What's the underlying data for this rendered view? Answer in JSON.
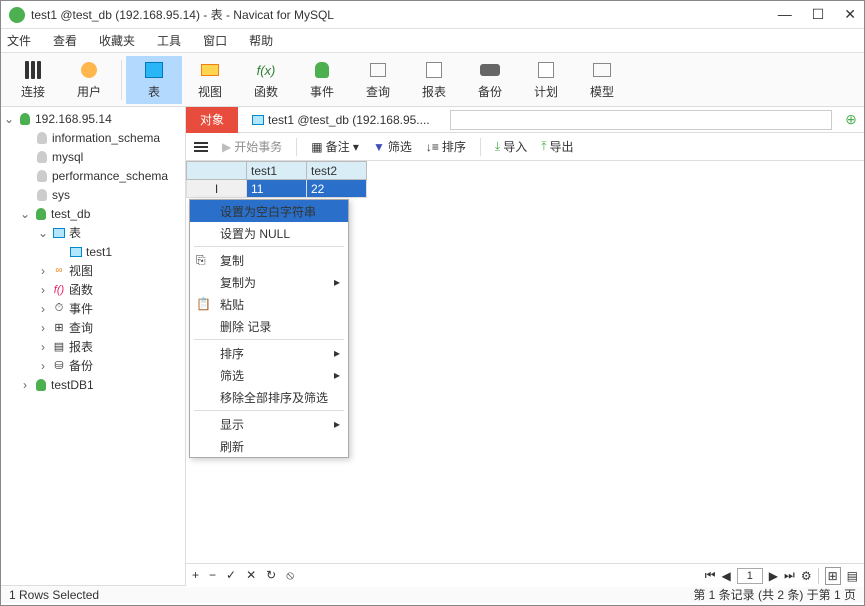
{
  "window": {
    "title": "test1 @test_db (192.168.95.14) - 表 - Navicat for MySQL"
  },
  "menubar": [
    "文件",
    "查看",
    "收藏夹",
    "工具",
    "窗口",
    "帮助"
  ],
  "toolbar": [
    {
      "label": "连接",
      "icon": "conn"
    },
    {
      "label": "用户",
      "icon": "user"
    },
    {
      "label": "表",
      "icon": "table",
      "active": true
    },
    {
      "label": "视图",
      "icon": "view"
    },
    {
      "label": "函数",
      "icon": "fn"
    },
    {
      "label": "事件",
      "icon": "event"
    },
    {
      "label": "查询",
      "icon": "query"
    },
    {
      "label": "报表",
      "icon": "report"
    },
    {
      "label": "备份",
      "icon": "backup"
    },
    {
      "label": "计划",
      "icon": "calendar"
    },
    {
      "label": "模型",
      "icon": "model"
    }
  ],
  "sidebar": {
    "connection": "192.168.95.14",
    "dbs_grey": [
      "information_schema",
      "mysql",
      "performance_schema",
      "sys"
    ],
    "db_open": {
      "name": "test_db",
      "tables_label": "表",
      "tables": [
        "test1"
      ],
      "children": [
        {
          "label": "视图",
          "icon": "view"
        },
        {
          "label": "函数",
          "icon": "fn"
        },
        {
          "label": "事件",
          "icon": "event"
        },
        {
          "label": "查询",
          "icon": "query"
        },
        {
          "label": "报表",
          "icon": "report"
        },
        {
          "label": "备份",
          "icon": "backup"
        }
      ]
    },
    "db_closed": "testDB1"
  },
  "tabs": {
    "active": "对象",
    "second": "test1 @test_db (192.168.95...."
  },
  "subtoolbar": {
    "begin": "开始事务",
    "memo": "备注 ▾",
    "filter": "筛选",
    "sort": "排序",
    "import": "导入",
    "export": "导出"
  },
  "grid": {
    "columns": [
      "test1",
      "test2"
    ],
    "rows": [
      [
        "11",
        "22"
      ]
    ]
  },
  "context_menu": [
    {
      "label": "设置为空白字符串",
      "highlighted": true
    },
    {
      "label": "设置为 NULL"
    },
    {
      "sep": true
    },
    {
      "label": "复制",
      "icon": "copy"
    },
    {
      "label": "复制为",
      "sub": true
    },
    {
      "label": "粘贴",
      "icon": "paste"
    },
    {
      "label": "删除 记录",
      "boxed": true
    },
    {
      "sep": true
    },
    {
      "label": "排序",
      "sub": true
    },
    {
      "label": "筛选",
      "sub": true
    },
    {
      "label": "移除全部排序及筛选"
    },
    {
      "sep": true
    },
    {
      "label": "显示",
      "sub": true
    },
    {
      "label": "刷新"
    }
  ],
  "bottombar": {
    "page": "1"
  },
  "statusbar": {
    "left": "1 Rows Selected",
    "right": "第 1 条记录 (共 2 条) 于第 1 页"
  }
}
